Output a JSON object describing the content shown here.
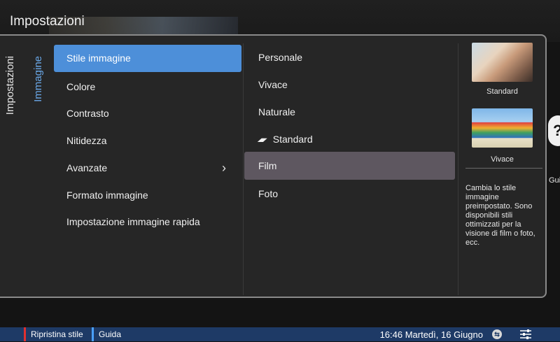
{
  "app": {
    "title": "Impostazioni"
  },
  "vertical_tabs": [
    "Impostazioni",
    "Immagine"
  ],
  "menu": {
    "items": [
      {
        "label": "Stile immagine",
        "selected": true
      },
      {
        "label": "Colore"
      },
      {
        "label": "Contrasto"
      },
      {
        "label": "Nitidezza"
      },
      {
        "label": "Avanzate",
        "has_submenu": true
      },
      {
        "label": "Formato immagine"
      },
      {
        "label": "Impostazione immagine rapida"
      }
    ]
  },
  "options": {
    "items": [
      {
        "label": "Personale"
      },
      {
        "label": "Vivace"
      },
      {
        "label": "Naturale"
      },
      {
        "label": "Standard",
        "icon": "leaf-icon"
      },
      {
        "label": "Film",
        "selected": true
      },
      {
        "label": "Foto"
      }
    ]
  },
  "preview": {
    "images": [
      {
        "label": "Standard"
      },
      {
        "label": "Vivace"
      }
    ],
    "description": "Cambia lo stile immagine preimpostato. Sono disponibili stili ottimizzati per la visione di film o foto, ecc."
  },
  "help": {
    "label": "Gui"
  },
  "bottom_bar": {
    "red_button": "Ripristina stile",
    "blue_button": "Guida",
    "datetime": "16:46 Martedì, 16 Giugno"
  },
  "colors": {
    "accent_blue": "#4d8fd9",
    "selected_option": "#5e5760",
    "bottom_bar": "#1e3a66",
    "red_key": "#e03030"
  }
}
